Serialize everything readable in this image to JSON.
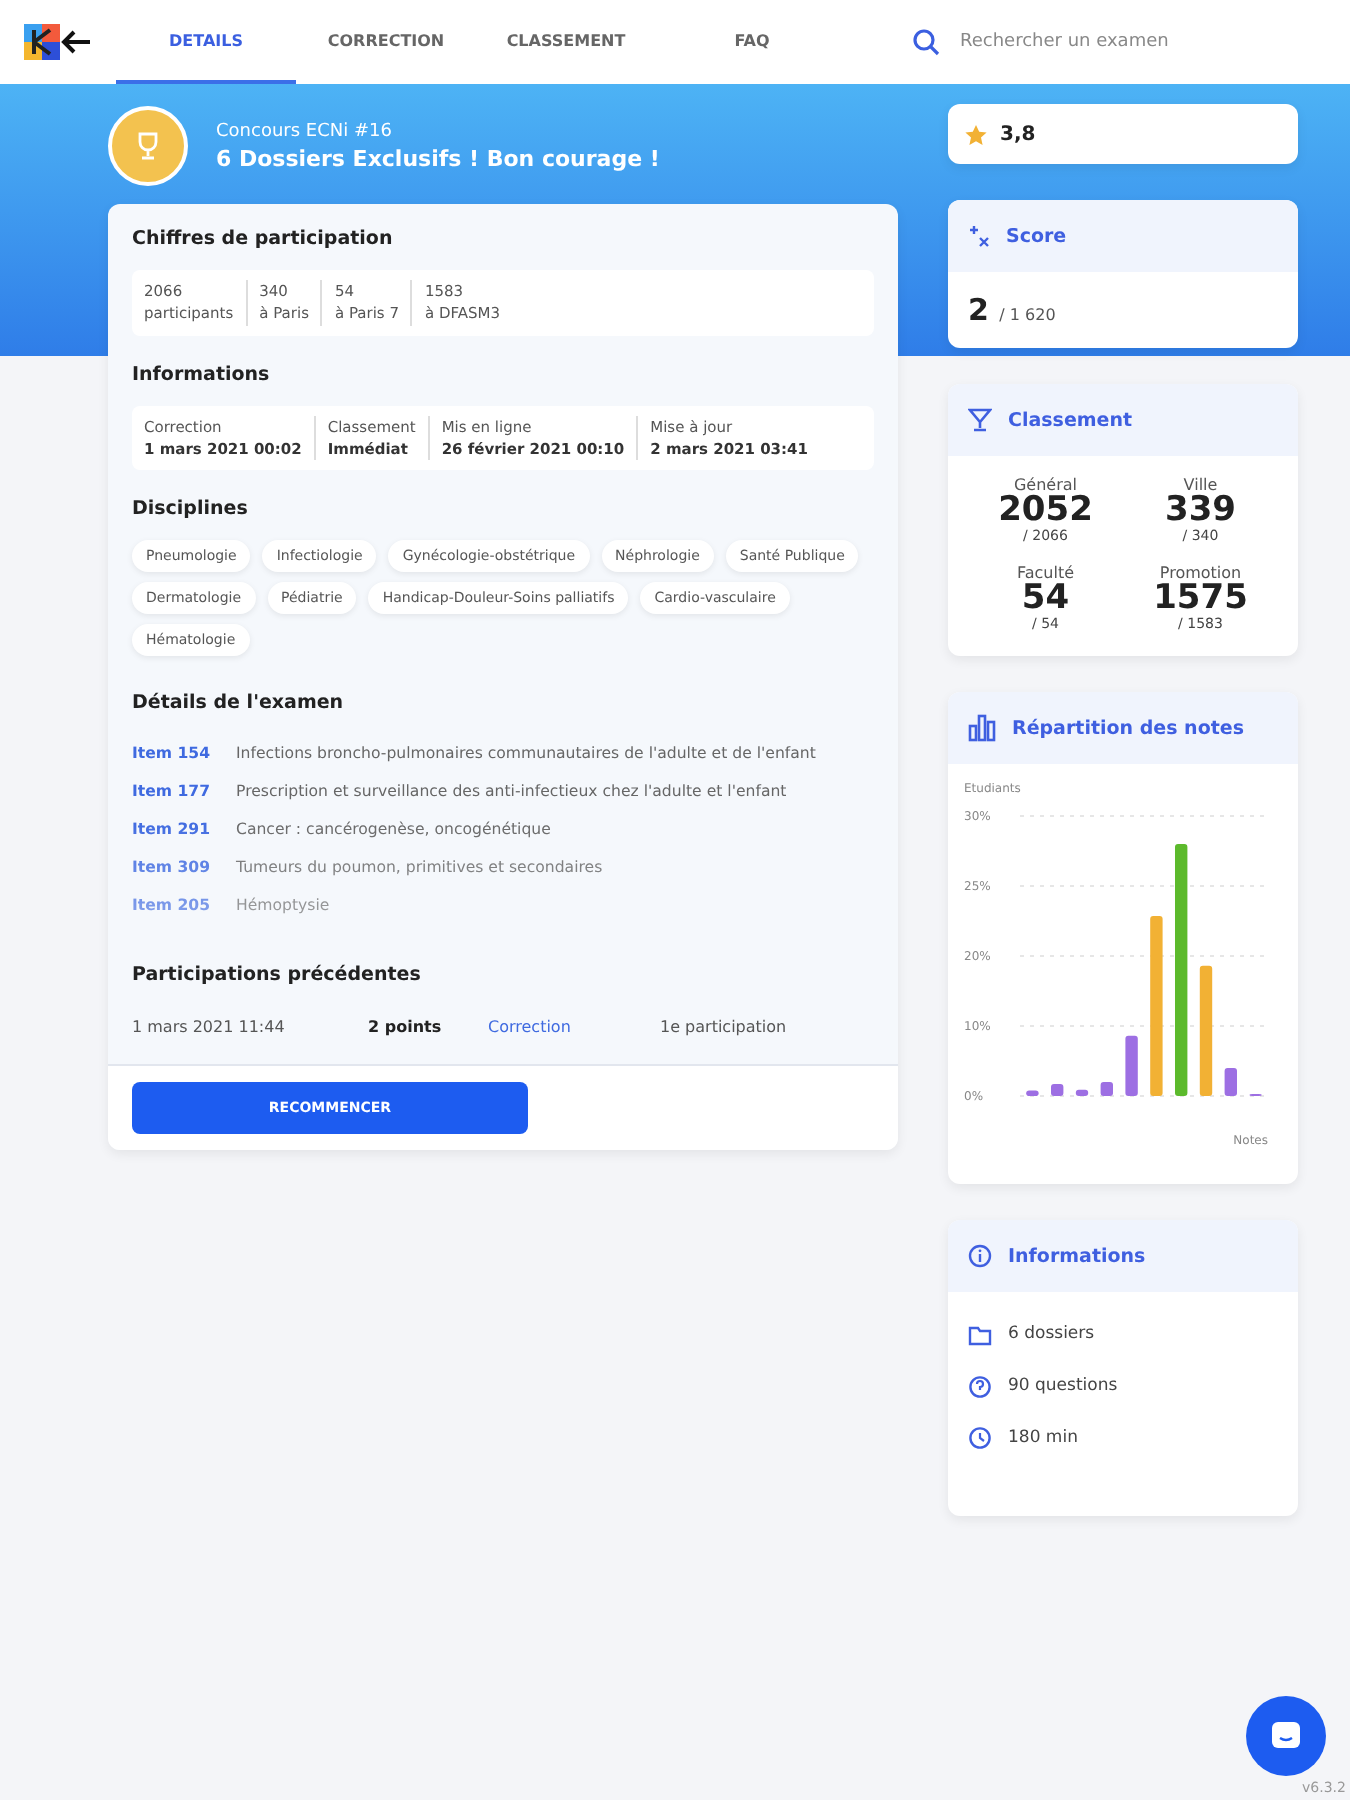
{
  "nav": {
    "tabs": [
      {
        "label": "DETAILS",
        "selected": true
      },
      {
        "label": "CORRECTION",
        "selected": false
      },
      {
        "label": "CLASSEMENT",
        "selected": false
      },
      {
        "label": "FAQ",
        "selected": false
      }
    ],
    "search": {
      "placeholder": "Rechercher un examen"
    }
  },
  "header": {
    "subtitle": "Concours ECNi #16",
    "title": "6 Dossiers Exclusifs ! Bon courage !",
    "rating": "3,8"
  },
  "participation": {
    "title": "Chiffres de participation",
    "stats": [
      {
        "value": "2066",
        "label": "participants"
      },
      {
        "value": "340",
        "label": "à Paris"
      },
      {
        "value": "54",
        "label": "à Paris 7"
      },
      {
        "value": "1583",
        "label": "à DFASM3"
      }
    ]
  },
  "informations": {
    "title": "Informations",
    "fields": [
      {
        "label": "Correction",
        "value": "1 mars 2021 00:02"
      },
      {
        "label": "Classement",
        "value": "Immédiat"
      },
      {
        "label": "Mis en ligne",
        "value": "26 février 2021 00:10"
      },
      {
        "label": "Mise à jour",
        "value": "2 mars 2021 03:41"
      }
    ]
  },
  "disciplines": {
    "title": "Disciplines",
    "tags": [
      "Pneumologie",
      "Infectiologie",
      "Gynécologie-obstétrique",
      "Néphrologie",
      "Santé Publique",
      "Dermatologie",
      "Pédiatrie",
      "Handicap-Douleur-Soins palliatifs",
      "Cardio-vasculaire",
      "Hématologie"
    ]
  },
  "exam_details": {
    "title": "Détails de l'examen",
    "items": [
      {
        "code": "Item 154",
        "text": "Infections broncho-pulmonaires communautaires de l'adulte et de l'enfant"
      },
      {
        "code": "Item 177",
        "text": "Prescription et surveillance des anti-infectieux chez l'adulte et l'enfant"
      },
      {
        "code": "Item 291",
        "text": "Cancer : cancérogenèse, oncogénétique"
      },
      {
        "code": "Item 309",
        "text": "Tumeurs du poumon, primitives et secondaires"
      },
      {
        "code": "Item 205",
        "text": "Hémoptysie"
      }
    ]
  },
  "previous": {
    "title": "Participations précédentes",
    "rows": [
      {
        "date": "1 mars 2021 11:44",
        "points": "2 points",
        "link": "Correction",
        "rank": "1e participation"
      }
    ]
  },
  "restart_button": "RECOMMENCER",
  "score": {
    "title": "Score",
    "value": "2",
    "total": "/ 1 620"
  },
  "ranking": {
    "title": "Classement",
    "cells": [
      {
        "label": "Général",
        "value": "2052",
        "total": "/ 2066"
      },
      {
        "label": "Ville",
        "value": "339",
        "total": "/ 340"
      },
      {
        "label": "Faculté",
        "value": "54",
        "total": "/ 54"
      },
      {
        "label": "Promotion",
        "value": "1575",
        "total": "/ 1583"
      }
    ]
  },
  "distribution": {
    "title": "Répartition des notes",
    "ylabel": "Etudiants",
    "xlabel": "Notes",
    "tick_labels": [
      "30%",
      "25%",
      "20%",
      "10%",
      "0%"
    ]
  },
  "info_card": {
    "title": "Informations",
    "items": [
      {
        "kind": "folder",
        "text": "6 dossiers"
      },
      {
        "kind": "question",
        "text": "90 questions"
      },
      {
        "kind": "clock",
        "text": "180 min"
      }
    ]
  },
  "version": "v6.3.2"
}
